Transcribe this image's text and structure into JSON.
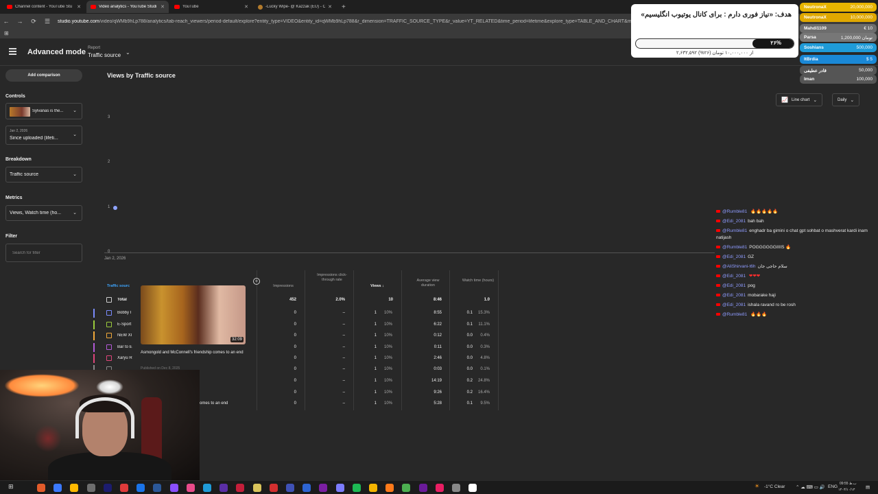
{
  "browser": {
    "tabs": [
      {
        "title": "Channel content - YouTube Stu",
        "active": false
      },
      {
        "title": "Video analytics - YouTube Studi",
        "active": true
      },
      {
        "title": "YouTube",
        "active": false
      },
      {
        "title": "-Lucky Wipe- @ Kazzak (EU) - C",
        "active": false
      }
    ],
    "url_host": "studio.youtube.com",
    "url_path": "/video/qWMb9hLp788/analytics/tab-reach_viewers/period-default/explore?entity_type=VIDEO&entity_id=qWMb9hLp788&r_dimension=TRAFFIC_SOURCE_TYPE&r_value=YT_RELATED&time_period=lifetime&explore_type=TABLE_AND_CHART&met"
  },
  "header": {
    "title": "Advanced mode",
    "report_label": "Report",
    "report_value": "Traffic source"
  },
  "sidebar": {
    "add_comparison": "Add comparison",
    "controls_label": "Controls",
    "video_select": "Sylvanas is the...",
    "date_small": "Jan 2, 2026",
    "date_value": "Since uploaded (lifeti...",
    "breakdown_label": "Breakdown",
    "breakdown_value": "Traffic source",
    "metrics_label": "Metrics",
    "metrics_value": "Views, Watch time (ho...",
    "filter_label": "Filter",
    "filter_placeholder": "Search for filter"
  },
  "main": {
    "title": "Views by Traffic source",
    "chart_type_btn": "Line chart",
    "granularity_btn": "Daily"
  },
  "chart_data": {
    "type": "line",
    "title": "Views by Traffic source",
    "x": [
      "Jan 2, 2026"
    ],
    "series": [
      {
        "values": [
          1
        ]
      }
    ],
    "yticks": [
      0,
      1,
      2,
      3
    ],
    "ylim": [
      0,
      3
    ],
    "xlabel": "",
    "ylabel": ""
  },
  "table": {
    "columns": {
      "name": "Traffic sourc",
      "impressions": "Impressions",
      "ctr": "Impressions click-through rate",
      "views": "Views",
      "avd": "Average view duration",
      "watch": "Watch time (hours)"
    },
    "total": {
      "name": "Total",
      "impressions": "452",
      "ctr": "2.0%",
      "views": "10",
      "avd": "8:46",
      "watch": "1.0"
    },
    "rows": [
      {
        "name": "Bobby I",
        "color": "#7b8cff",
        "impressions": "0",
        "ctr": "–",
        "views": "1",
        "vpct": "10%",
        "avd": "8:55",
        "watch": "0.1",
        "wpct": "15.3%"
      },
      {
        "name": "E-Sport",
        "color": "#9ccc3c",
        "impressions": "0",
        "ctr": "–",
        "views": "1",
        "vpct": "10%",
        "avd": "6:22",
        "watch": "0.1",
        "wpct": "11.1%"
      },
      {
        "name": "NEW XI",
        "color": "#f2a93b",
        "impressions": "0",
        "ctr": "–",
        "views": "1",
        "vpct": "10%",
        "avd": "0:12",
        "watch": "0.0",
        "wpct": "0.4%"
      },
      {
        "name": "Bar to E",
        "color": "#b45ad8",
        "impressions": "0",
        "ctr": "–",
        "views": "1",
        "vpct": "10%",
        "avd": "0:11",
        "watch": "0.0",
        "wpct": "0.3%"
      },
      {
        "name": "Xaryu R",
        "color": "#e0457b",
        "impressions": "0",
        "ctr": "–",
        "views": "1",
        "vpct": "10%",
        "avd": "2:46",
        "watch": "0.0",
        "wpct": "4.8%"
      },
      {
        "name": "",
        "color": "#888888",
        "impressions": "0",
        "ctr": "–",
        "views": "1",
        "vpct": "10%",
        "avd": "0:03",
        "watch": "0.0",
        "wpct": "0.1%"
      },
      {
        "name": "",
        "color": "#888888",
        "impressions": "0",
        "ctr": "–",
        "views": "1",
        "vpct": "10%",
        "avd": "14:19",
        "watch": "0.2",
        "wpct": "24.8%"
      },
      {
        "name": "",
        "color": "#888888",
        "impressions": "0",
        "ctr": "–",
        "views": "1",
        "vpct": "10%",
        "avd": "9:26",
        "watch": "0.2",
        "wpct": "16.4%"
      },
      {
        "name": "",
        "color": "#888888",
        "impressions": "0",
        "ctr": "–",
        "views": "1",
        "vpct": "10%",
        "avd": "5:28",
        "watch": "0.1",
        "wpct": "9.5%"
      }
    ],
    "last_row_tail": "omes to an end"
  },
  "hover_card": {
    "duration": "32:09",
    "title": "Asmongold and McConnell's friendship comes to an end",
    "subtitle": "Published on Dec 8, 2025"
  },
  "donation_goal": {
    "title": "هدف: «نیاز فوری دارم : برای کانال یوتیوب انگلیسیم»",
    "percent_label": "۲۶%",
    "percent": 26,
    "amount_text": "۲,۶۳۲,۵۹۲ از ۱۰,۰۰۰,۰۰۰ تومان (۲۶%)"
  },
  "leaderboard": [
    {
      "name": "NeutronaX",
      "amount": "20,000,000",
      "color": "#e7b400"
    },
    {
      "name": "NeutronaX",
      "amount": "10,000,000",
      "color": "#e0a800"
    },
    {
      "name": "Mahdi1109",
      "amount": "€ 10",
      "color": "#6d6d6d"
    },
    {
      "name": "Parsa",
      "amount": "1,200,000 تومان",
      "color": "#777777"
    },
    {
      "name": "Soshians",
      "amount": "500,000",
      "color": "#1f9bd8"
    },
    {
      "name": "ItBrdia",
      "amount": "$ 5",
      "color": "#1a88d6"
    },
    {
      "name": "قادر عطیفی",
      "amount": "50,000",
      "color": "#555555"
    },
    {
      "name": "Iman",
      "amount": "100,000",
      "color": "#555555"
    }
  ],
  "chat": [
    {
      "user": "@Rumble81",
      "text": "",
      "emoji": "🔥🔥🔥🔥🔥"
    },
    {
      "user": "@Edi_2081",
      "text": "bah bah",
      "emoji": ""
    },
    {
      "user": "@Rumble81",
      "text": "enghadr ba gimini o chat gpt sohbat o mashverat kardi inam natijash",
      "emoji": ""
    },
    {
      "user": "@Rumble81",
      "text": "POGGGGGGIIIIS",
      "emoji": "🔥"
    },
    {
      "user": "@Edi_2081",
      "text": "GZ",
      "emoji": ""
    },
    {
      "user": "@AliShirvani-t6h",
      "text": "سلام حاجی جان",
      "emoji": ""
    },
    {
      "user": "@Edi_2081",
      "text": "",
      "emoji": "❤❤❤"
    },
    {
      "user": "@Edi_2081",
      "text": "pog",
      "emoji": ""
    },
    {
      "user": "@Edi_2081",
      "text": "mobarake haji",
      "emoji": ""
    },
    {
      "user": "@Edi_2081",
      "text": "ishala ravand ro be rosh",
      "emoji": ""
    },
    {
      "user": "@Rumble81",
      "text": "",
      "emoji": "🔥🔥🔥"
    }
  ],
  "taskbar": {
    "weather": "-1°C Clear",
    "lang": "ENG",
    "time": "09:55 ب.ظ",
    "date": "۱۴۰۴/۱۰/۱۳"
  }
}
